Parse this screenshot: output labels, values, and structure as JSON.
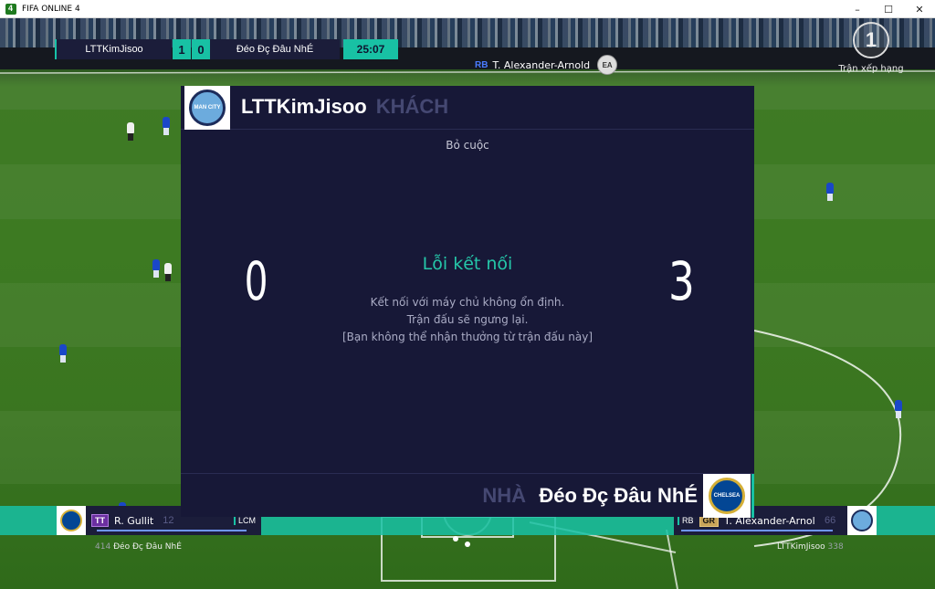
{
  "window": {
    "title": "FIFA ONLINE 4",
    "minimize": "–",
    "maximize": "☐",
    "close": "✕"
  },
  "scoreboard": {
    "home_team": "LTTKimJisoo",
    "home_score": "1",
    "away_score": "0",
    "away_team": "Đéo Đç Đâu NhÉ",
    "time": "25:07"
  },
  "player_indicator": {
    "position": "RB",
    "name": "T. Alexander-Arnold",
    "logo": "EA"
  },
  "rank": {
    "icon_text": "1",
    "label": "Trận xếp hạng"
  },
  "dialog": {
    "top_team": "LTTKimJisoo",
    "top_side": "KHÁCH",
    "forfeit": "Bỏ cuộc",
    "score_left": "0",
    "score_right": "3",
    "error_title": "Lỗi kết nối",
    "error_line1": "Kết nối với máy chủ không ổn định.",
    "error_line2": "Trận đấu sẽ ngưng lại.",
    "error_line3": "[Bạn không thể nhận thưởng từ trận đấu này]",
    "bottom_side": "NHÀ",
    "bottom_team": "Đéo Đç Đâu NhÉ",
    "top_crest": "MAN CITY",
    "bottom_crest": "CHELSEA"
  },
  "cards": {
    "left": {
      "badge": "TT",
      "name": "R. Gullit",
      "number": "12",
      "position": "LCM",
      "bar_fraction": 0.78
    },
    "right": {
      "position": "RB",
      "badge": "GR",
      "name": "T. Alexander-Arnol",
      "number": "66",
      "bar_fraction": 0.92
    }
  },
  "bottom": {
    "left_num": "414",
    "left_team": "Đéo Đç Đâu NhÉ",
    "right_team": "LTTKimJisoo",
    "right_num": "338"
  },
  "colors": {
    "accent": "#18c1a4",
    "dialog_bg": "#171837",
    "error_title": "#25c7a9"
  }
}
